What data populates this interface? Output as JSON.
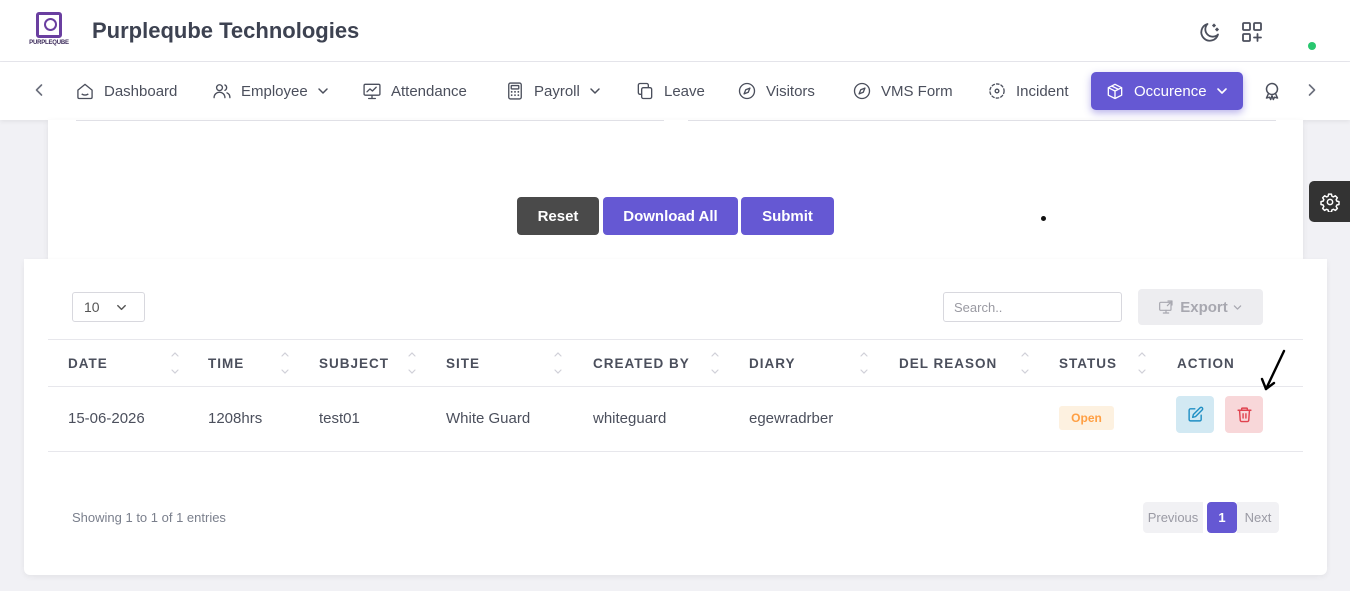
{
  "header": {
    "logo_text": "PURPLEQUBE",
    "brand": "Purpleqube Technologies",
    "icons": [
      "moon-icon",
      "apps-add-icon"
    ],
    "status_color": "#28c76f"
  },
  "nav": {
    "items": [
      {
        "label": "Dashboard",
        "icon": "home-icon"
      },
      {
        "label": "Employee",
        "icon": "users-icon",
        "dropdown": true
      },
      {
        "label": "Attendance",
        "icon": "monitor-chart-icon"
      },
      {
        "label": "Payroll",
        "icon": "calculator-icon",
        "dropdown": true
      },
      {
        "label": "Leave",
        "icon": "copy-icon"
      },
      {
        "label": "Visitors",
        "icon": "compass-icon"
      },
      {
        "label": "VMS Form",
        "icon": "compass-icon"
      },
      {
        "label": "Incident",
        "icon": "focus-icon"
      },
      {
        "label": "Occurence",
        "icon": "box-icon",
        "dropdown": true,
        "active": true
      }
    ],
    "accent": "#6558d3"
  },
  "form": {
    "reset_label": "Reset",
    "download_label": "Download All",
    "submit_label": "Submit"
  },
  "table": {
    "page_length": "10",
    "search_placeholder": "Search..",
    "export_label": "Export",
    "columns": [
      "DATE",
      "TIME",
      "SUBJECT",
      "SITE",
      "CREATED BY",
      "DIARY",
      "DEL REASON",
      "STATUS",
      "ACTION"
    ],
    "rows": [
      {
        "date": "15-06-2026",
        "time": "1208hrs",
        "subject": "test01",
        "site": "White Guard",
        "created_by": "whiteguard",
        "diary": "egewradrber",
        "del_reason": "",
        "status": "Open"
      }
    ],
    "showing": "Showing 1 to 1 of 1 entries",
    "pagination": {
      "previous": "Previous",
      "current": "1",
      "next": "Next"
    }
  }
}
